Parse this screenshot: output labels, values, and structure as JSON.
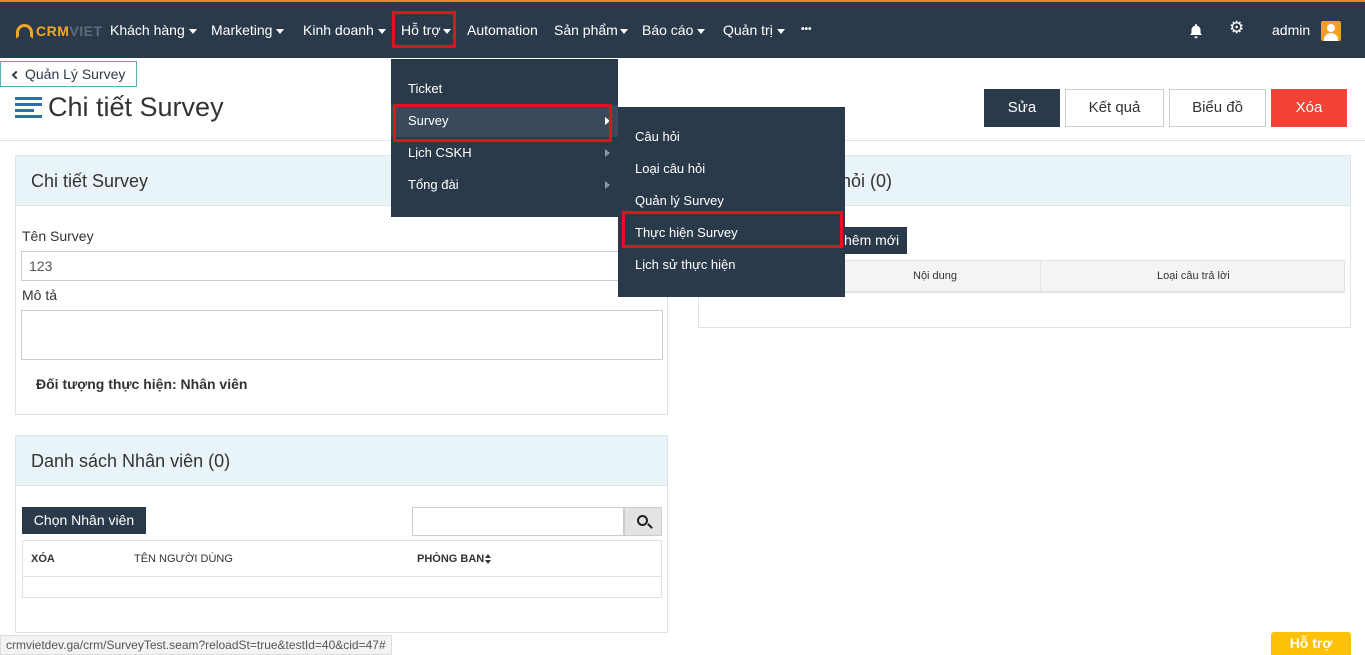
{
  "app": {
    "logo_crm": "CRM",
    "logo_viet": "VIET"
  },
  "nav": {
    "items": [
      {
        "label": "Khách hàng"
      },
      {
        "label": "Marketing"
      },
      {
        "label": "Kinh doanh"
      },
      {
        "label": "Hỗ trợ"
      },
      {
        "label": "Automation"
      },
      {
        "label": "Sản phẩm"
      },
      {
        "label": "Báo cáo"
      },
      {
        "label": "Quản trị"
      },
      {
        "label": "•••"
      }
    ],
    "user": "admin",
    "icons": [
      "bell-icon",
      "gear-icon",
      "user-avatar-icon"
    ]
  },
  "back": {
    "label": "Quản Lý Survey"
  },
  "page": {
    "title": "Chi tiết Survey"
  },
  "actions": {
    "edit": "Sửa",
    "result": "Kết quả",
    "chart": "Biểu đồ",
    "delete": "Xóa"
  },
  "detail": {
    "heading": "Chi tiết Survey",
    "name_label": "Tên Survey",
    "name_value": "123",
    "desc_label": "Mô tả",
    "desc_value": "",
    "target": "Đối tượng thực hiện: Nhân viên"
  },
  "employees": {
    "heading": "Danh sách Nhân viên (0)",
    "choose_btn": "Chọn Nhân viên",
    "search_placeholder": "",
    "columns": [
      "XÓA",
      "TÊN NGƯỜI DÙNG",
      "PHÒNG BAN"
    ]
  },
  "questions": {
    "heading_fragment": "hỏi (0)",
    "add_fragment": "hêm mới",
    "columns": [
      "Nội dung",
      "Loại câu trả lời"
    ]
  },
  "menu_support": {
    "items": [
      "Ticket",
      "Survey",
      "Lịch CSKH",
      "Tổng đài"
    ]
  },
  "menu_survey": {
    "items": [
      "Câu hỏi",
      "Loại câu hỏi",
      "Quản lý Survey",
      "Thực hiện Survey",
      "Lịch sử thực hiện"
    ]
  },
  "status_url": "crmvietdev.ga/crm/SurveyTest.seam?reloadSt=true&testId=40&cid=47#",
  "help": "Hỗ trợ",
  "colors": {
    "nav_bg": "#2b3a4a",
    "accent": "#f5a623",
    "danger": "#f44336",
    "highlight": "#e0141e"
  }
}
